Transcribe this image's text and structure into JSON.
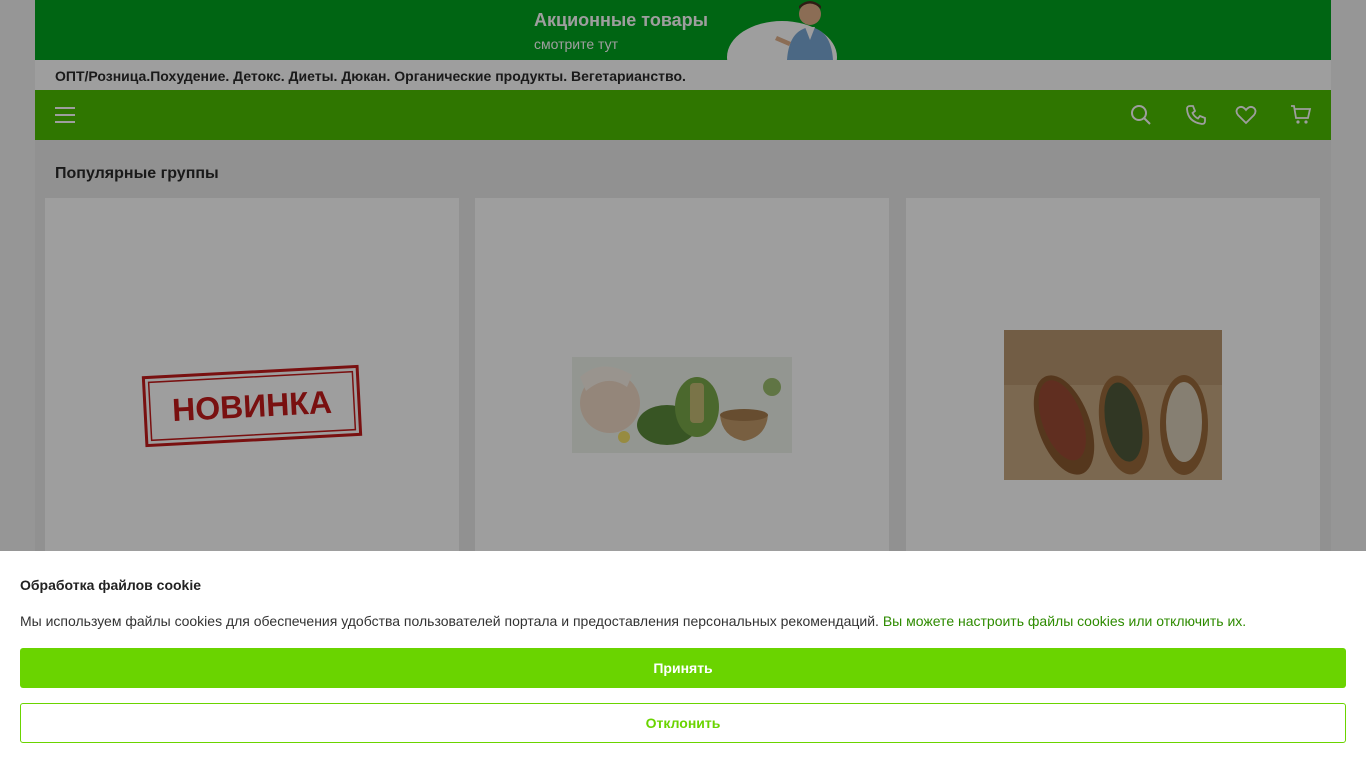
{
  "banner": {
    "title": "Акционные товары",
    "subtitle": "смотрите тут",
    "bg_color": "#00a31f"
  },
  "tagline": "ОПТ/Розница.Похудение. Детокс. Диеты. Дюкан. Органические продукты. Вегетарианство.",
  "navbar": {
    "bg_color": "#4cbf00",
    "icons": [
      "menu-icon",
      "search-icon",
      "phone-icon",
      "heart-icon",
      "cart-icon"
    ]
  },
  "popular_groups": {
    "title": "Популярные группы",
    "cards": [
      {
        "image": "novinka-stamp",
        "stamp_text": "НОВИНКА"
      },
      {
        "image": "herbal-cosmetics-photo"
      },
      {
        "image": "seeds-in-scoops-photo"
      }
    ]
  },
  "cookie": {
    "title": "Обработка файлов cookie",
    "text": "Мы используем файлы cookies для обеспечения удобства пользователей портала и предоставления персональных рекомендаций.",
    "link_text": "Вы можете настроить файлы cookies или отключить их.",
    "accept_label": "Принять",
    "decline_label": "Отклонить",
    "accent_color": "#6ad400"
  }
}
